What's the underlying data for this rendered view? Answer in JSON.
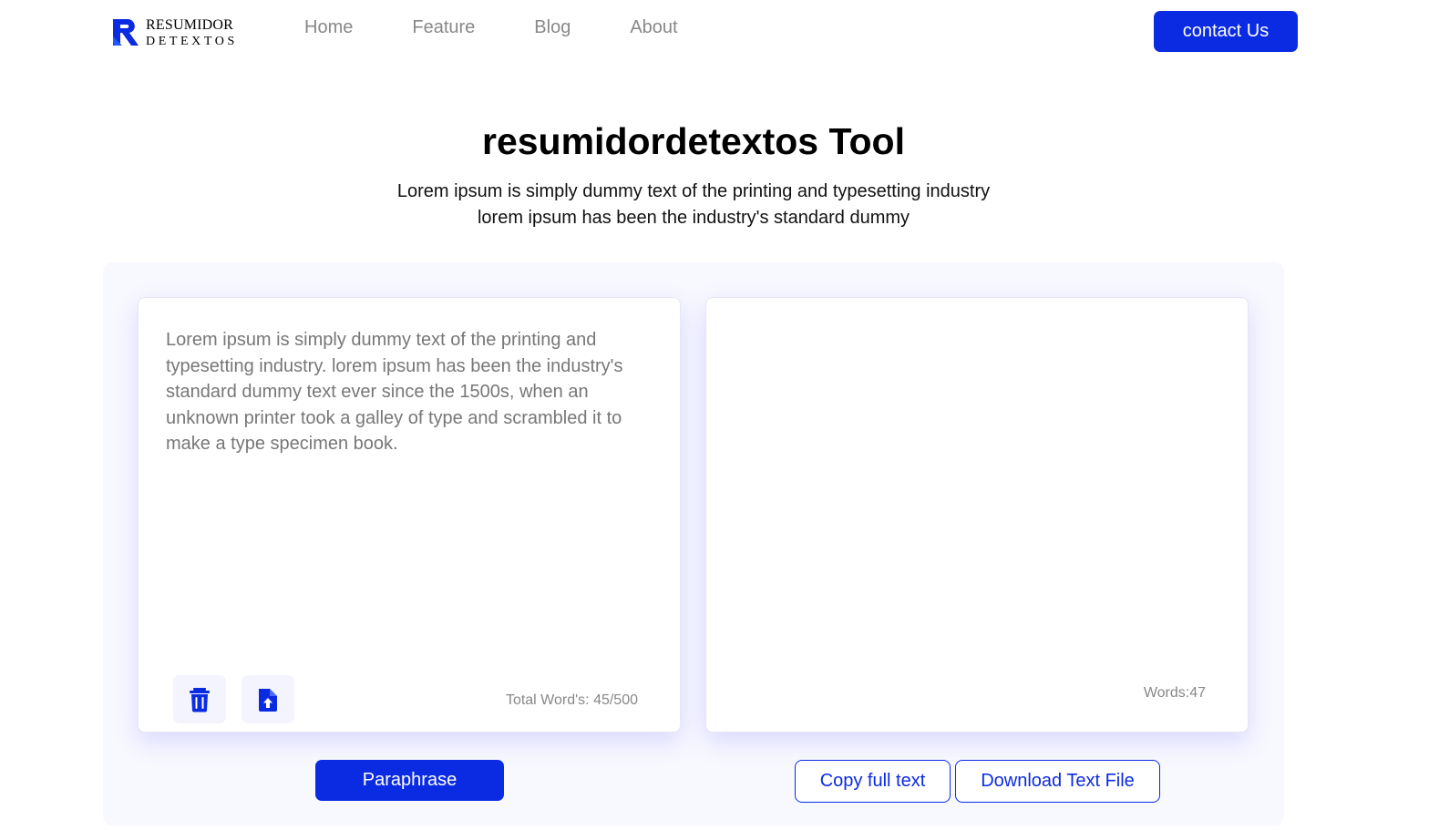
{
  "logo": {
    "line1": "RESUMIDOR",
    "line2": "DETEXTOS"
  },
  "nav": {
    "items": [
      "Home",
      "Feature",
      "Blog",
      "About"
    ]
  },
  "header": {
    "contact_label": "contact Us"
  },
  "hero": {
    "title": "resumidordetextos Tool",
    "subtitle_line1": "Lorem ipsum is simply dummy text of the printing and typesetting industry",
    "subtitle_line2": "lorem ipsum has been the industry's standard dummy"
  },
  "tool": {
    "input_text": "Lorem ipsum is simply dummy text of the printing and typesetting industry. lorem ipsum has been the industry's standard dummy text ever since the 1500s, when an unknown printer took a galley of type and scrambled it to make a type specimen book.",
    "word_count": "Total Word's: 45/500",
    "output_words": "Words:47",
    "paraphrase_label": "Paraphrase",
    "copy_label": "Copy full text",
    "download_label": "Download Text File"
  },
  "colors": {
    "accent": "#0b2be3",
    "panel_bg": "#f8f8ff",
    "muted_text": "#888888"
  },
  "icons": {
    "logo": "r-logo-icon",
    "delete": "trash-icon",
    "upload": "file-upload-icon"
  }
}
